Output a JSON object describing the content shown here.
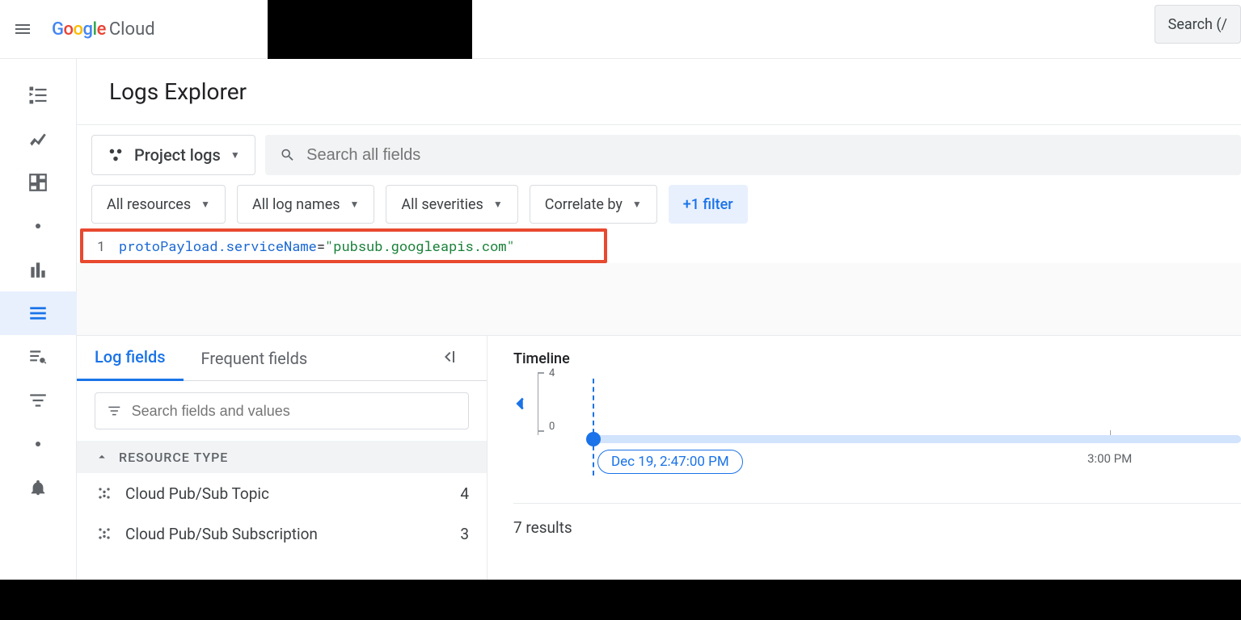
{
  "header": {
    "logo_cloud": "Cloud",
    "search_button": "Search (/"
  },
  "page": {
    "title": "Logs Explorer"
  },
  "toolbar": {
    "scope_label": "Project logs",
    "search_placeholder": "Search all fields"
  },
  "filters": {
    "resources": "All resources",
    "lognames": "All log names",
    "severities": "All severities",
    "correlate": "Correlate by",
    "add_filter": "+1 filter"
  },
  "query": {
    "line_no": "1",
    "key": "protoPayload.serviceName",
    "op": "=",
    "val": "\"pubsub.googleapis.com\""
  },
  "fields_panel": {
    "tabs": {
      "log_fields": "Log fields",
      "frequent": "Frequent fields"
    },
    "search_placeholder": "Search fields and values",
    "group_header": "RESOURCE TYPE",
    "items": [
      {
        "label": "Cloud Pub/Sub Topic",
        "count": "4"
      },
      {
        "label": "Cloud Pub/Sub Subscription",
        "count": "3"
      }
    ]
  },
  "timeline": {
    "title": "Timeline",
    "y_max": "4",
    "y_min": "0",
    "start_label": "Dec 19, 2:47:00 PM",
    "tick_3pm": "3:00 PM",
    "results": "7 results"
  }
}
